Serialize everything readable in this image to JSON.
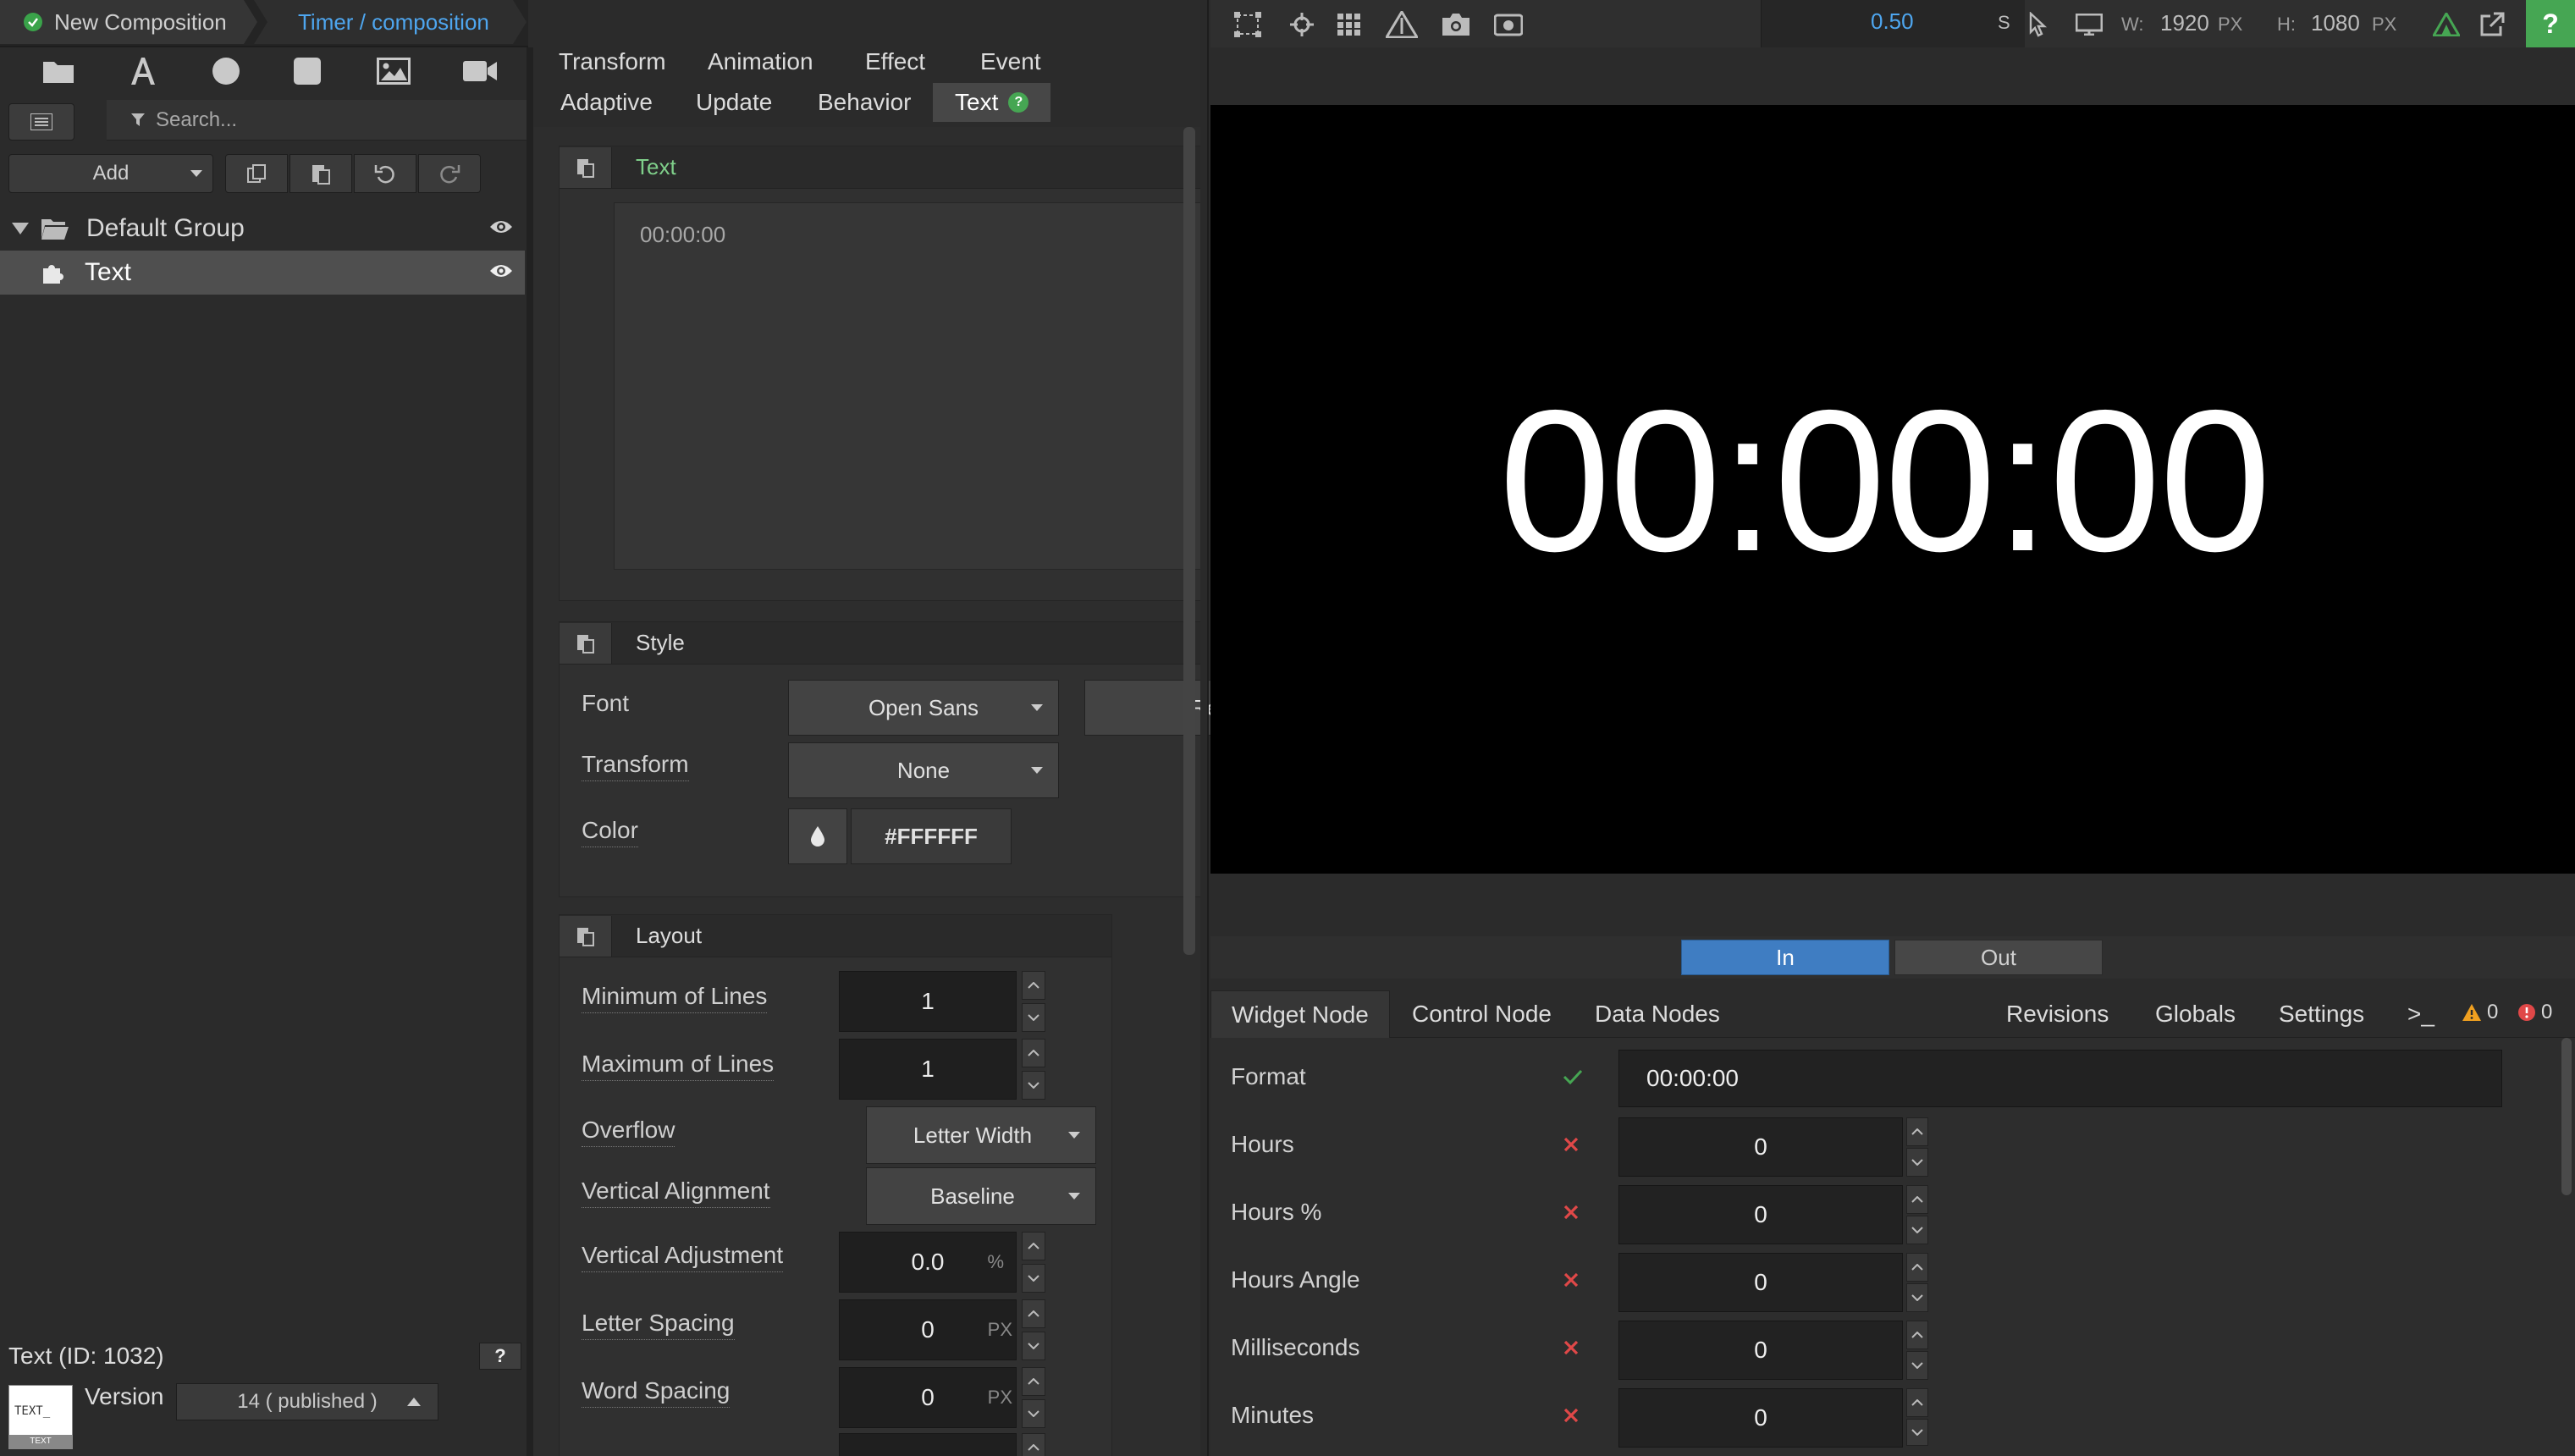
{
  "breadcrumb": {
    "item1": "New Composition",
    "item2": "Timer / composition"
  },
  "left": {
    "search_placeholder": "Search...",
    "add_label": "Add",
    "tree": {
      "group": "Default Group",
      "item": "Text"
    },
    "selected_info": "Text (ID: 1032)",
    "help_label": "?",
    "version_label": "Version",
    "version_value": "14 ( published )",
    "thumb_text": "TEXT_",
    "thumb_caption": "TEXT"
  },
  "mid": {
    "tabs_row1": [
      "Transform",
      "Animation",
      "Effect",
      "Event"
    ],
    "tabs_row2": [
      "Adaptive",
      "Update",
      "Behavior",
      "Text"
    ],
    "text_section": {
      "title": "Text",
      "value": "00:00:00"
    },
    "style_section": {
      "title": "Style",
      "font_label": "Font",
      "font_value": "Open Sans",
      "font_weight": "Re",
      "transform_label": "Transform",
      "transform_value": "None",
      "color_label": "Color",
      "color_value": "#FFFFFF"
    },
    "layout_section": {
      "title": "Layout",
      "min_lines_label": "Minimum of Lines",
      "min_lines": "1",
      "max_lines_label": "Maximum of Lines",
      "max_lines": "1",
      "overflow_label": "Overflow",
      "overflow_value": "Letter Width",
      "valign_label": "Vertical Alignment",
      "valign_value": "Baseline",
      "vadjust_label": "Vertical Adjustment",
      "vadjust_value": "0.0",
      "vadjust_unit": "%",
      "letter_label": "Letter Spacing",
      "letter_value": "0",
      "letter_unit": "PX",
      "word_label": "Word Spacing",
      "word_value": "0",
      "word_unit": "PX"
    }
  },
  "right": {
    "duration": "0.50",
    "duration_unit": "S",
    "width_label": "W:",
    "width": "1920",
    "width_unit": "PX",
    "height_label": "H:",
    "height": "1080",
    "height_unit": "PX",
    "help": "?",
    "preview_text": "00:00:00",
    "in_label": "In",
    "out_label": "Out",
    "node_tabs": [
      "Widget Node",
      "Control Node",
      "Data Nodes"
    ],
    "right_tabs": [
      "Revisions",
      "Globals",
      "Settings"
    ],
    "console_label": ">_",
    "warn_count": "0",
    "error_count": "0",
    "props": {
      "format_label": "Format",
      "format_value": "00:00:00",
      "hours_label": "Hours",
      "hours_value": "0",
      "hours_pct_label": "Hours %",
      "hours_pct_value": "0",
      "hours_angle_label": "Hours Angle",
      "hours_angle_value": "0",
      "ms_label": "Milliseconds",
      "ms_value": "0",
      "minutes_label": "Minutes",
      "minutes_value": "0"
    }
  },
  "colors": {
    "accent_blue": "#4ea6ef",
    "ok_green": "#46a653",
    "error_red": "#e04848",
    "warn_orange": "#f0a020"
  }
}
